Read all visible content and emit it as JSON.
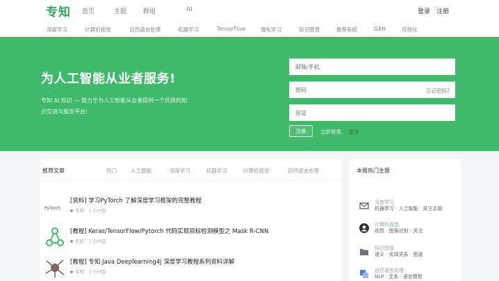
{
  "brand": {
    "logo_text": "专知",
    "accent": "#3fba6a"
  },
  "topnav": {
    "items": [
      "首页",
      "主题",
      "群组",
      "AI"
    ],
    "login": "登录",
    "register": "注册"
  },
  "tags": [
    "深度学习",
    "计算机视觉",
    "自然语言处理",
    "机器学习",
    "TensorFlow",
    "强化学习",
    "知识图谱",
    "推荐系统",
    "GAN",
    "可视化"
  ],
  "hero": {
    "title": "为人工智能从业者服务!",
    "desc_line1": "专知 AI 知识 — 致力于为人工智能从业者提供一个优质的知",
    "desc_line2": "识交流与服务平台!",
    "email_placeholder": "邮箱/手机",
    "password_placeholder": "密码",
    "forgot_link": "忘记密码?",
    "captcha_placeholder": "验证",
    "register_button": "注册",
    "link1": "立即登录",
    "link2": "更多"
  },
  "feed": {
    "header": "推荐文章",
    "tabs": [
      "热门",
      "人工智能",
      "深度学习",
      "机器学习",
      "计算机视觉",
      "自然语言处理"
    ],
    "items": [
      {
        "title": "[资料] 学习PyTorch 了解深度学习框架的完整教程",
        "meta": "专知 · 1 小时前",
        "thumb": "pytorch"
      },
      {
        "title": "[教程] Keras/TensorFlow/Pytorch 代码实现目标检测模型之 Mask R-CNN",
        "meta": "专知 · 2 小时前",
        "thumb": "network"
      },
      {
        "title": "[教程] 专知 Java Deeplearning4j 深度学习教程系列资料详解",
        "meta": "专知 · 3 小时前",
        "thumb": "neuron"
      }
    ]
  },
  "sidebar": {
    "title": "本周热门主题",
    "rows": [
      {
        "t1": "深度学习",
        "t2": "机器学习 · 人工智能 · 关注主题",
        "icon": "mail-icon"
      },
      {
        "t1": "计算机视觉",
        "t2": "视觉 · 图像识别 · 关注",
        "icon": "user-icon"
      },
      {
        "t1": "知识图谱",
        "t2": "语义 · 实体关系 · 图谱",
        "icon": "folder-icon"
      },
      {
        "t1": "自然语言处理",
        "t2": "NLP · 文本 · 语言模型",
        "icon": "translate-icon"
      }
    ]
  }
}
